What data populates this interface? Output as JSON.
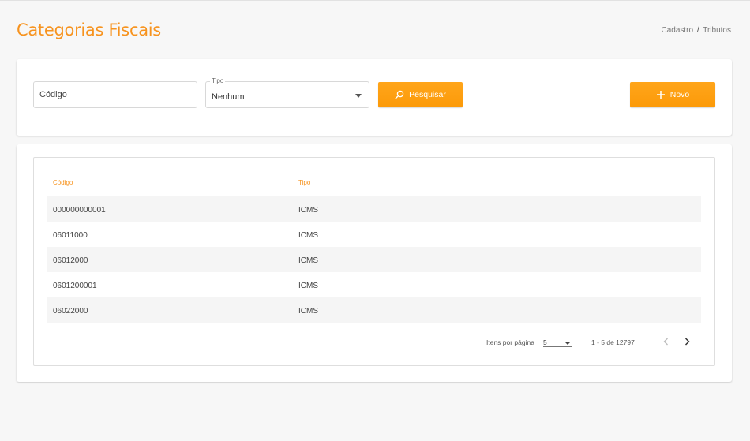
{
  "header": {
    "title": "Categorias Fiscais",
    "breadcrumb": {
      "first": "Cadastro",
      "separator": "/",
      "second": "Tributos"
    }
  },
  "search": {
    "codigo_placeholder": "Código",
    "tipo_label": "Tipo",
    "tipo_value": "Nenhum",
    "search_button": "Pesquisar",
    "new_button": "Novo"
  },
  "table": {
    "columns": [
      "Código",
      "Tipo"
    ],
    "rows": [
      {
        "codigo": "000000000001",
        "tipo": "ICMS"
      },
      {
        "codigo": "06011000",
        "tipo": "ICMS"
      },
      {
        "codigo": "06012000",
        "tipo": "ICMS"
      },
      {
        "codigo": "0601200001",
        "tipo": "ICMS"
      },
      {
        "codigo": "06022000",
        "tipo": "ICMS"
      }
    ]
  },
  "paginator": {
    "items_per_page_label": "Itens por página",
    "page_size": "5",
    "range_label": "1 - 5 de 12797"
  },
  "colors": {
    "accent": "#f7931e",
    "button": "#fca010"
  },
  "icons": {
    "search": "search-icon",
    "add": "plus-icon",
    "prev": "chevron-left-icon",
    "next": "chevron-right-icon"
  }
}
